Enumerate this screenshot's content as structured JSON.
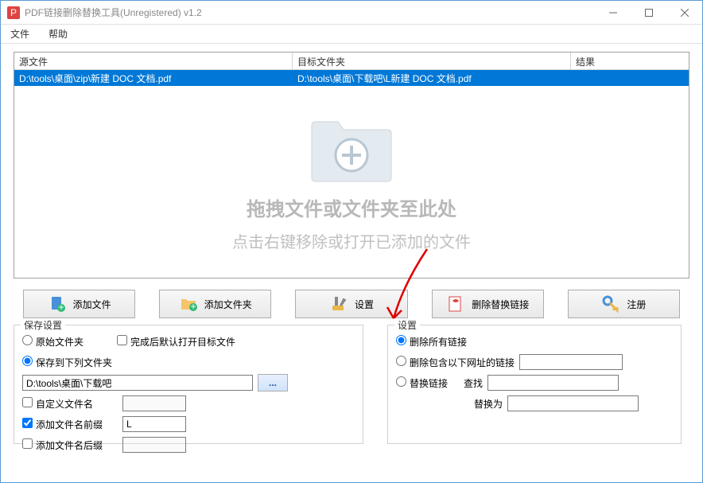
{
  "window": {
    "title": "PDF链接删除替换工具(Unregistered) v1.2"
  },
  "menu": {
    "file": "文件",
    "help": "帮助"
  },
  "table": {
    "col_source": "源文件",
    "col_target": "目标文件夹",
    "col_result": "结果",
    "row1_source": "D:\\tools\\桌面\\zip\\新建 DOC 文档.pdf",
    "row1_target": "D:\\tools\\桌面\\下载吧\\L新建 DOC 文档.pdf",
    "row1_result": ""
  },
  "drop": {
    "line1": "拖拽文件或文件夹至此处",
    "line2": "点击右键移除或打开已添加的文件"
  },
  "toolbar": {
    "add_file": "添加文件",
    "add_folder": "添加文件夹",
    "settings": "设置",
    "delete_replace": "删除替换链接",
    "register": "注册"
  },
  "save": {
    "group_title": "保存设置",
    "original_folder": "原始文件夹",
    "open_after": "完成后默认打开目标文件",
    "save_to_below": "保存到下列文件夹",
    "path_value": "D:\\tools\\桌面\\下载吧",
    "browse": "...",
    "custom_name": "自定义文件名",
    "add_prefix": "添加文件名前缀",
    "prefix_value": "L",
    "add_suffix": "添加文件名后缀",
    "suffix_value": ""
  },
  "link": {
    "group_title": "设置",
    "delete_all": "删除所有链接",
    "delete_url": "删除包含以下网址的链接",
    "url_value": "",
    "replace": "替换链接",
    "find": "查找",
    "find_value": "",
    "replace_with": "替换为",
    "replace_value": ""
  }
}
